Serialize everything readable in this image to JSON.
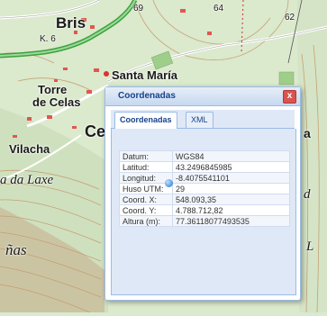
{
  "map": {
    "labels": {
      "bris": "Bris",
      "k6": "K. 6",
      "santa_maria": "Santa María",
      "torre": "Torre",
      "de_celas": "de Celas",
      "vilacha": "Vilacha",
      "a_da_laxe": "a da Laxe",
      "nas": "ñas",
      "ce": "Ce",
      "a_right": "a",
      "d_right": "d",
      "l_right": "L",
      "contour_69": "69",
      "contour_64": "64",
      "contour_62": "62"
    }
  },
  "dialog": {
    "title": "Coordenadas",
    "close_glyph": "x",
    "tabs": [
      {
        "label": "Coordenadas",
        "active": true
      },
      {
        "label": "XML",
        "active": false
      }
    ],
    "rows": [
      {
        "key": "Datum:",
        "value": "WGS84"
      },
      {
        "key": "Latitud:",
        "value": "43.2496845985"
      },
      {
        "key": "Longitud:",
        "value": "-8.4075541101"
      },
      {
        "key": "Huso UTM:",
        "value": "29"
      },
      {
        "key": "Coord. X:",
        "value": "548.093,35"
      },
      {
        "key": "Coord. Y:",
        "value": "4.788.712,82"
      },
      {
        "key": "Altura (m):",
        "value": "77.36118077493535"
      }
    ]
  }
}
